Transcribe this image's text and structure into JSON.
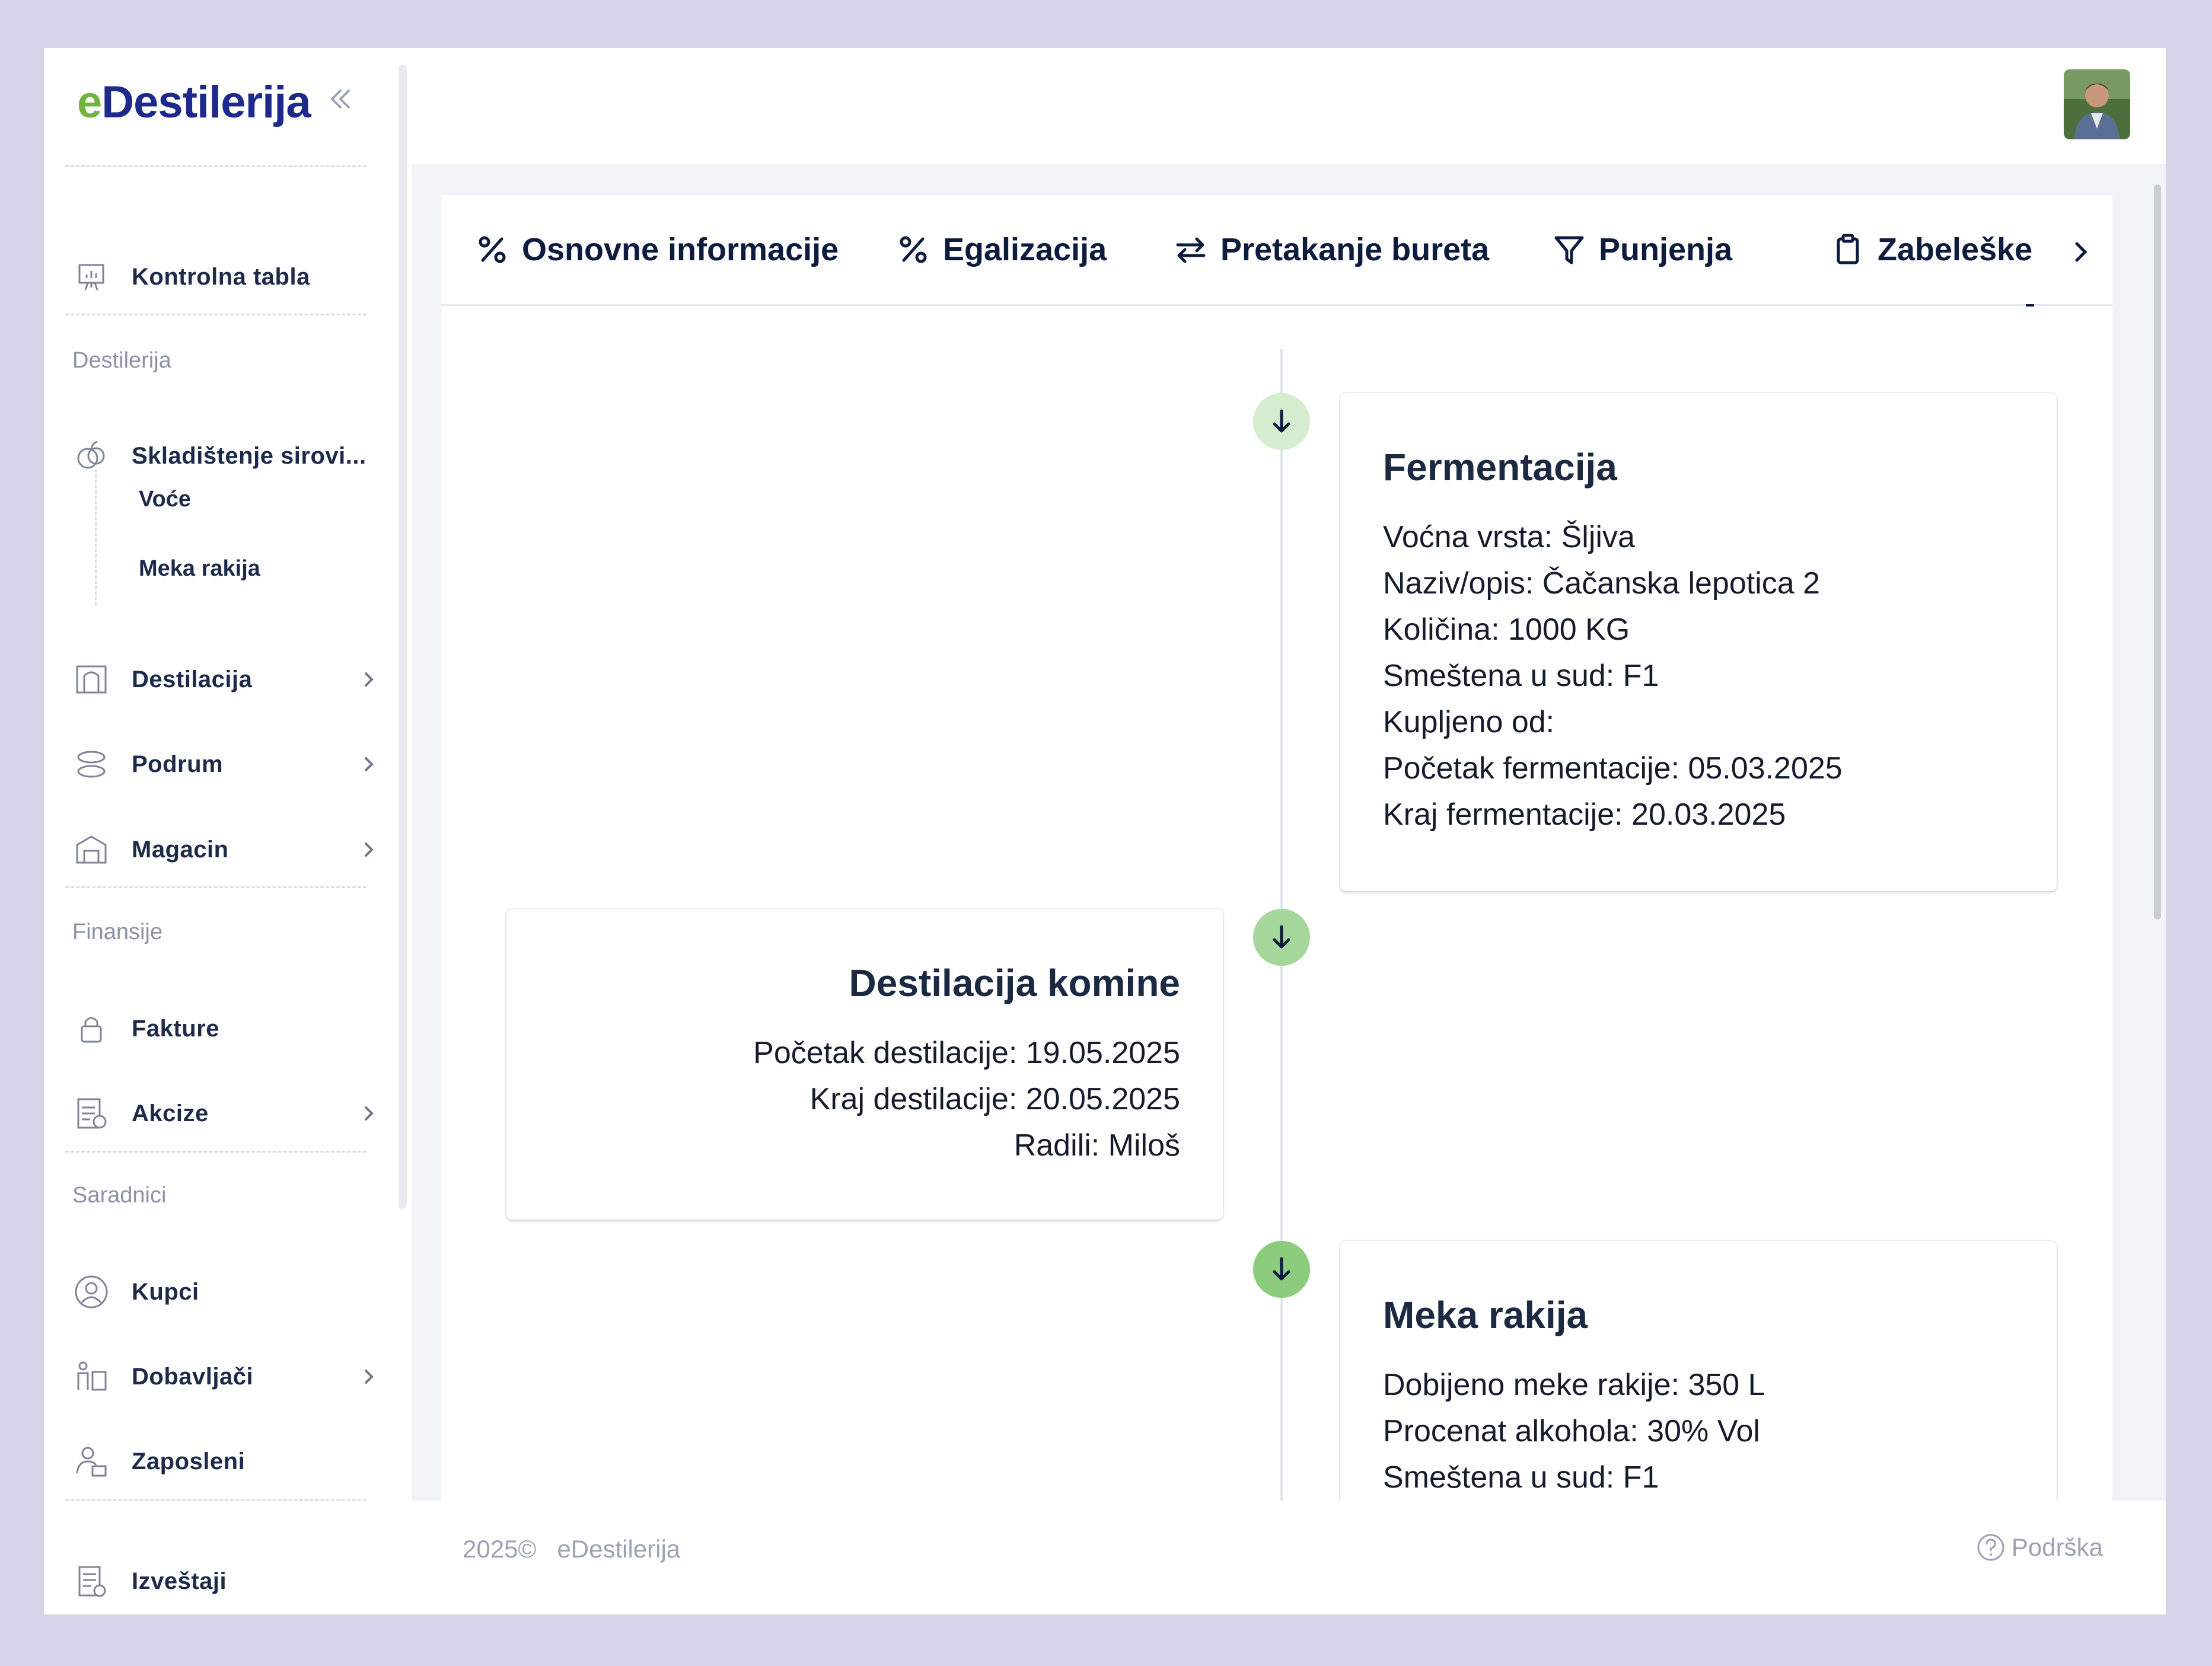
{
  "brand": {
    "e": "e",
    "rest": "Destilerija"
  },
  "sidebar": {
    "items": [
      {
        "label": "Kontrolna tabla"
      },
      {
        "label": "Skladištenje sirovi..."
      },
      {
        "label": "Destilacija"
      },
      {
        "label": "Podrum"
      },
      {
        "label": "Magacin"
      },
      {
        "label": "Fakture"
      },
      {
        "label": "Akcize"
      },
      {
        "label": "Kupci"
      },
      {
        "label": "Dobavljači"
      },
      {
        "label": "Zaposleni"
      },
      {
        "label": "Izveštaji"
      }
    ],
    "subitems": [
      {
        "label": "Voće"
      },
      {
        "label": "Meka rakija"
      }
    ],
    "sections": [
      {
        "label": "Destilerija"
      },
      {
        "label": "Finansije"
      },
      {
        "label": "Saradnici"
      }
    ]
  },
  "tabs": [
    {
      "label": "Osnovne informacije"
    },
    {
      "label": "Egalizacija"
    },
    {
      "label": "Pretakanje bureta"
    },
    {
      "label": "Punjenja"
    },
    {
      "label": "Zabeleške"
    }
  ],
  "timeline": [
    {
      "title": "Fermentacija",
      "lines": [
        "Voćna vrsta: Šljiva",
        "Naziv/opis: Čačanska lepotica 2",
        "Količina: 1000 KG",
        "Smeštena u sud: F1",
        "Kupljeno od:",
        "Početak fermentacije: 05.03.2025",
        "Kraj fermentacije: 20.03.2025"
      ]
    },
    {
      "title": "Destilacija komine",
      "lines": [
        "Početak destilacije: 19.05.2025",
        "Kraj destilacije: 20.05.2025",
        "Radili: Miloš"
      ]
    },
    {
      "title": "Meka rakija",
      "lines": [
        "Dobijeno meke rakije: 350 L",
        "Procenat alkohola: 30% Vol",
        "Smeštena u sud: F1"
      ]
    }
  ],
  "footer": {
    "year": "2025©",
    "brand": "eDestilerija",
    "support": "Podrška"
  },
  "colors": {
    "brand_green": "#6fb43f",
    "brand_blue": "#1d2a8c",
    "dot_light": "#d6edd0",
    "dot_mid": "#a5d79a",
    "dot_dark": "#8ccc7d"
  }
}
